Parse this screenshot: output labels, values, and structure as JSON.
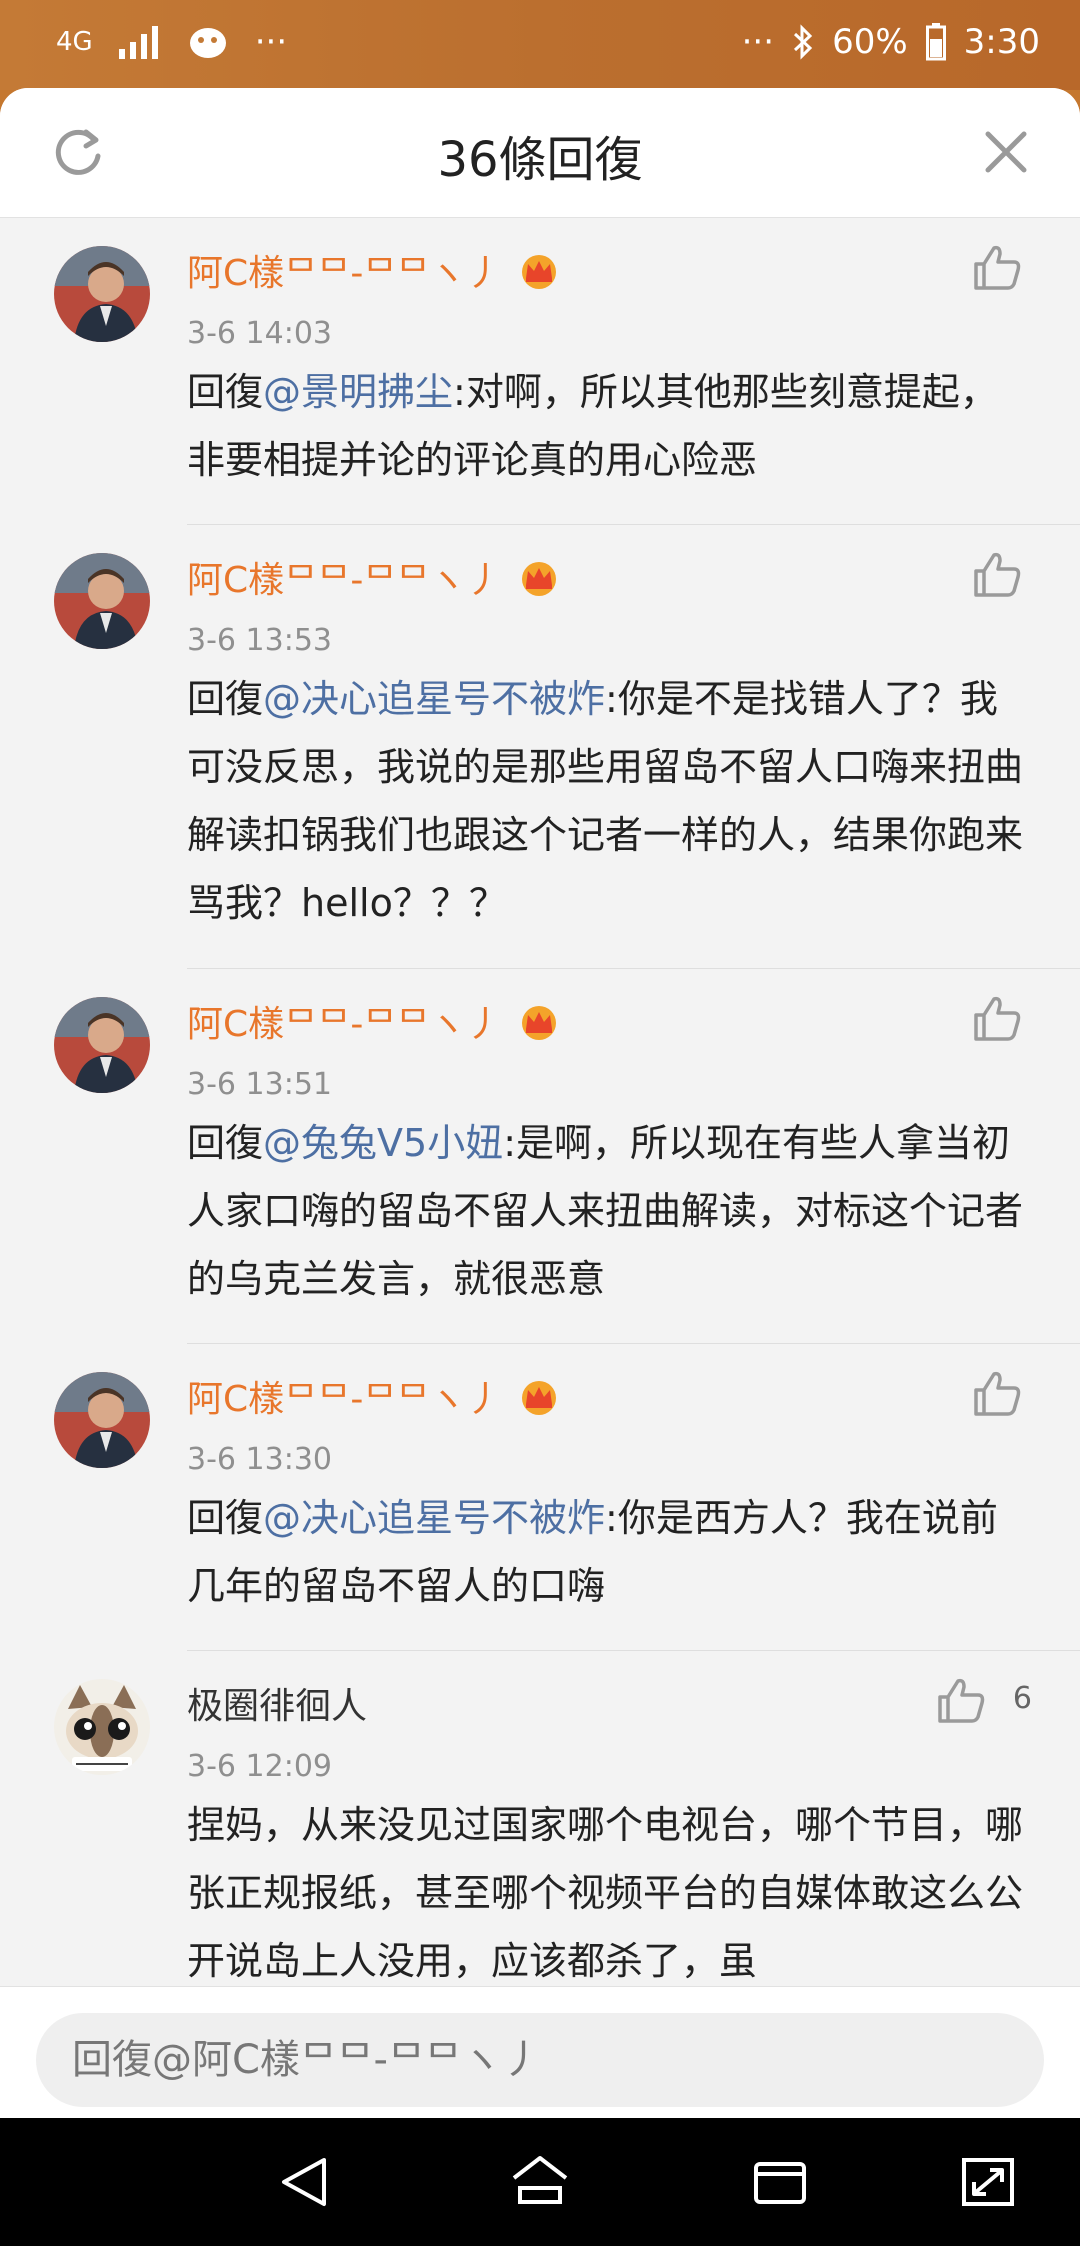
{
  "status_bar": {
    "network": "4G",
    "dots_left": "···",
    "dots_right": "···",
    "battery": "60%",
    "time": "3:30"
  },
  "header": {
    "title": "36條回復",
    "refresh_icon": "refresh-icon",
    "close_icon": "close-icon"
  },
  "comments": [
    {
      "username": "阿C樣ᄆᄆ-ᄆᄆヽ丿",
      "timestamp": "3-6 14:03",
      "prefix": "回復",
      "mention": "@景明拂尘",
      "text": ":对啊，所以其他那些刻意提起，非要相提并论的评论真的用心险恶",
      "likes": ""
    },
    {
      "username": "阿C樣ᄆᄆ-ᄆᄆヽ丿",
      "timestamp": "3-6 13:53",
      "prefix": "回復",
      "mention": "@决心追星号不被炸",
      "text": ":你是不是找错人了？我可没反思，我说的是那些用留岛不留人口嗨来扭曲解读扣锅我们也跟这个记者一样的人，结果你跑来骂我？hello？？？",
      "likes": ""
    },
    {
      "username": "阿C樣ᄆᄆ-ᄆᄆヽ丿",
      "timestamp": "3-6 13:51",
      "prefix": "回復",
      "mention": "@兔兔V5小妞",
      "text": ":是啊，所以现在有些人拿当初人家口嗨的留岛不留人来扭曲解读，对标这个记者的乌克兰发言，就很恶意",
      "likes": ""
    },
    {
      "username": "阿C樣ᄆᄆ-ᄆᄆヽ丿",
      "timestamp": "3-6 13:30",
      "prefix": "回復",
      "mention": "@决心追星号不被炸",
      "text": ":你是西方人？我在说前几年的留岛不留人的口嗨",
      "likes": ""
    },
    {
      "username": "极圈徘徊人",
      "timestamp": "3-6 12:09",
      "prefix": "",
      "mention": "",
      "text": "捏妈，从来没见过国家哪个电视台，哪个节目，哪张正规报纸，甚至哪个视频平台的自媒体敢这么公开说岛上人没用，应该都杀了，虽",
      "likes": "6"
    }
  ],
  "reply_input": {
    "placeholder": "回復@阿C樣ᄆᄆ-ᄆᄆヽ丿"
  },
  "nav": {
    "back_icon": "back-icon",
    "home_icon": "home-icon",
    "recents_icon": "recents-icon",
    "expand_icon": "expand-icon"
  },
  "colors": {
    "status_bar": "#c47a36",
    "username_vip": "#e8762b",
    "mention": "#4d6fa3",
    "background": "#f3f3f3"
  }
}
